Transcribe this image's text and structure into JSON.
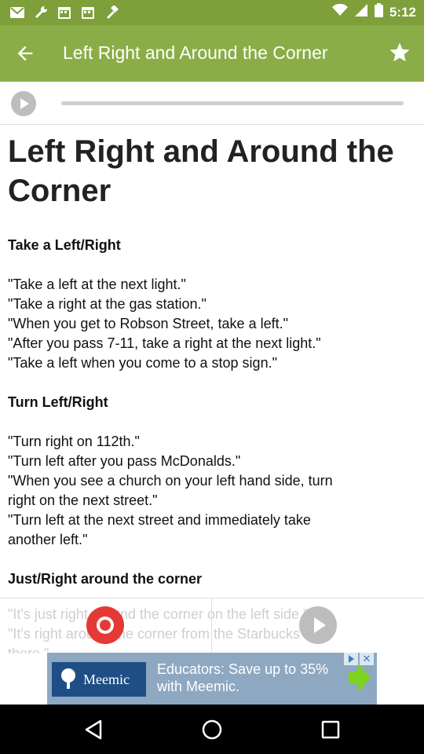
{
  "status_bar": {
    "time": "5:12",
    "icons": [
      "mail-icon",
      "wrench-icon",
      "calendar-icon",
      "calendar-icon",
      "hammer-icon",
      "wifi-icon",
      "signal-icon",
      "battery-icon"
    ]
  },
  "app_bar": {
    "title": "Left Right and Around the Corner",
    "back_icon": "arrow-left-icon",
    "star_icon": "star-icon"
  },
  "audio_player": {
    "play_icon": "play-icon",
    "progress_fraction": 0
  },
  "article": {
    "heading": "Left Right and Around the Corner",
    "lines": [
      {
        "text": "Take a Left/Right",
        "bold": true
      },
      {
        "text": "",
        "bold": false
      },
      {
        "text": "\"Take a left at the next light.\"",
        "bold": false
      },
      {
        "text": "\"Take a right at the gas station.\"",
        "bold": false
      },
      {
        "text": "\"When you get to Robson Street, take a left.\"",
        "bold": false
      },
      {
        "text": "\"After you pass 7-11, take a right at the next light.\"",
        "bold": false
      },
      {
        "text": "\"Take a left when you come to a stop sign.\"",
        "bold": false
      },
      {
        "text": "",
        "bold": false
      },
      {
        "text": "Turn Left/Right",
        "bold": true
      },
      {
        "text": "",
        "bold": false
      },
      {
        "text": "\"Turn right on 112th.\"",
        "bold": false
      },
      {
        "text": "\"Turn left after you pass McDonalds.\"",
        "bold": false
      },
      {
        "text": "\"When you see a church on your left hand side, turn",
        "bold": false
      },
      {
        "text": "right on the next street.\"",
        "bold": false
      },
      {
        "text": "\"Turn left at the next street and immediately take",
        "bold": false
      },
      {
        "text": "another left.\"",
        "bold": false
      },
      {
        "text": "",
        "bold": false
      },
      {
        "text": "Just/Right around the corner",
        "bold": true
      }
    ]
  },
  "faded_text": {
    "line1": "\"It's just right around the corner on the left side.\"",
    "line2": "\"It's right around the corner from the Starbucks over",
    "line3": "there.\""
  },
  "recorder": {
    "record_icon": "record-icon",
    "play_icon": "play-icon"
  },
  "ad": {
    "brand": "Meemic",
    "text": "Educators: Save up to 35% with Meemic.",
    "colors": {
      "background": "#8ea8c2",
      "logo_bg": "#1f4e86",
      "arrow": "#7ed321"
    }
  },
  "nav_bar": {
    "icons": [
      "back-triangle-icon",
      "home-circle-icon",
      "recents-square-icon"
    ]
  },
  "colors": {
    "status_bar": "#7e9f3a",
    "app_bar": "#8bad47",
    "record": "#e53935"
  }
}
